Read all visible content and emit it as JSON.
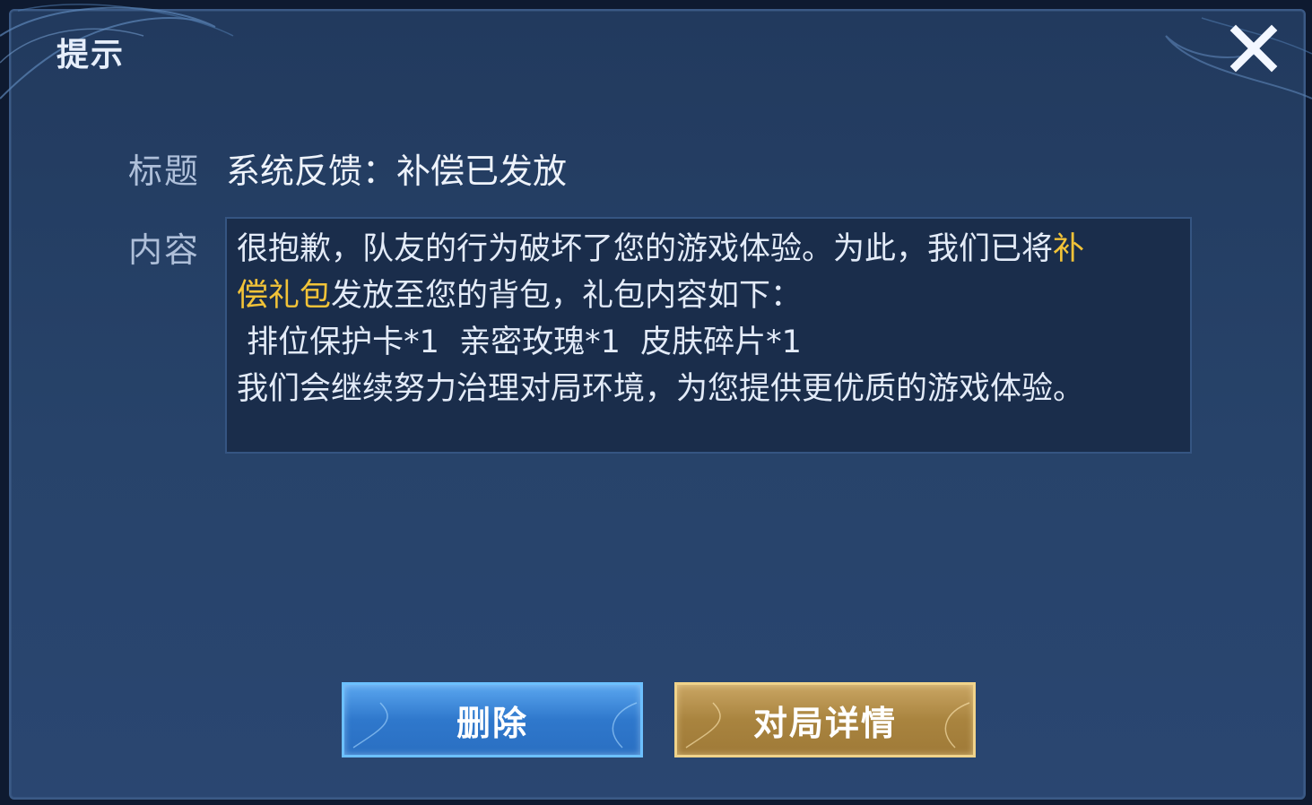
{
  "dialog": {
    "title": "提示",
    "subject_label": "标题",
    "subject": "系统反馈：补偿已发放",
    "content_label": "内容",
    "content": {
      "line1_text": "很抱歉，队友的行为破坏了您的游戏体验。为此，我们已将",
      "line1_highlight": "补",
      "line2_highlight": "偿礼包",
      "line2_text": "发放至您的背包，礼包内容如下：",
      "line3": " 排位保护卡*1  亲密玫瑰*1  皮肤碎片*1",
      "line4": "我们会继续努力治理对局环境，为您提供更优质的游戏体验。"
    },
    "buttons": {
      "delete_label": "删除",
      "detail_label": "对局详情"
    }
  },
  "colors": {
    "highlight": "#f2c338",
    "delete_button": "#2f78cc",
    "detail_button": "#a9843f"
  },
  "icons": {
    "close": "close-icon"
  }
}
